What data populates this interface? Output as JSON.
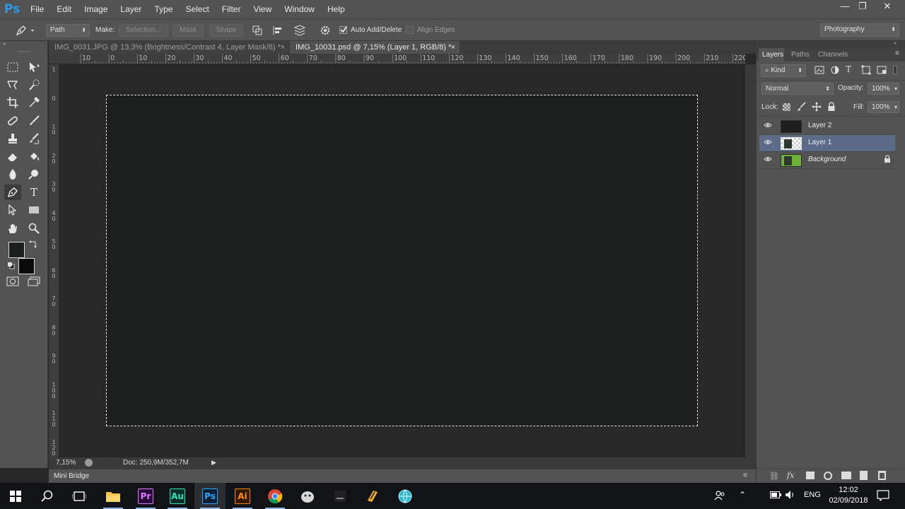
{
  "app": {
    "logo": "Ps"
  },
  "menubar": {
    "items": [
      "File",
      "Edit",
      "Image",
      "Layer",
      "Type",
      "Select",
      "Filter",
      "View",
      "Window",
      "Help"
    ]
  },
  "window_controls": {
    "minimize": "—",
    "restore": "❐",
    "close": "✕"
  },
  "options_bar": {
    "mode_select": "Path",
    "make_label": "Make:",
    "selection_button": "Selection...",
    "mask_button": "Mask",
    "shape_button": "Shape",
    "auto_add_delete": {
      "label": "Auto Add/Delete",
      "checked": true
    },
    "align_edges": {
      "label": "Align Edges",
      "checked": false
    },
    "workspace": "Photography"
  },
  "document_tabs": [
    {
      "title": "IMG_0031.JPG @ 13,3% (Brightness/Contrast 4, Layer Mask/8) *",
      "active": false,
      "close": "×"
    },
    {
      "title": "IMG_10031.psd @ 7,15% (Layer 1, RGB/8) *",
      "active": true,
      "close": "×"
    }
  ],
  "ruler_top": [
    "10",
    "0",
    "10",
    "20",
    "30",
    "40",
    "50",
    "60",
    "70",
    "80",
    "90",
    "100",
    "110",
    "120",
    "130",
    "140",
    "150",
    "160",
    "170",
    "180",
    "190",
    "200",
    "210",
    "220"
  ],
  "ruler_left": [
    "1",
    "0",
    "1\n0",
    "2\n0",
    "3\n0",
    "4\n0",
    "5\n0",
    "6\n0",
    "7\n0",
    "8\n0",
    "9\n0",
    "1\n0\n0",
    "1\n1\n0",
    "1\n2\n0"
  ],
  "status": {
    "zoom": "7,15%",
    "doc": "Doc: 250,9M/352,7M"
  },
  "mini_bridge": {
    "label": "Mini Bridge"
  },
  "layers_panel": {
    "tabs": [
      "Layers",
      "Paths",
      "Channels"
    ],
    "filter": "Kind",
    "blend_mode": "Normal",
    "opacity_label": "Opacity:",
    "opacity": "100%",
    "lock_label": "Lock:",
    "fill_label": "Fill:",
    "fill": "100%",
    "layers": [
      {
        "name": "Layer 2",
        "selected": false,
        "locked": false
      },
      {
        "name": "Layer 1",
        "selected": true,
        "locked": false
      },
      {
        "name": "Background",
        "selected": false,
        "locked": true
      }
    ]
  },
  "taskbar": {
    "language": "ENG",
    "time": "12:02",
    "date": "02/09/2018",
    "apps": [
      "Pr",
      "Au",
      "Ps",
      "Ai"
    ]
  },
  "colors": {
    "ps_blue": "#2b9bec",
    "selected_layer": "#5c6c88",
    "canvas": "#1d1f1e",
    "premiere": "#2a0a3a",
    "audition": "#0a2e2a",
    "photoshop": "#0a1f33",
    "illustrator": "#331800"
  }
}
